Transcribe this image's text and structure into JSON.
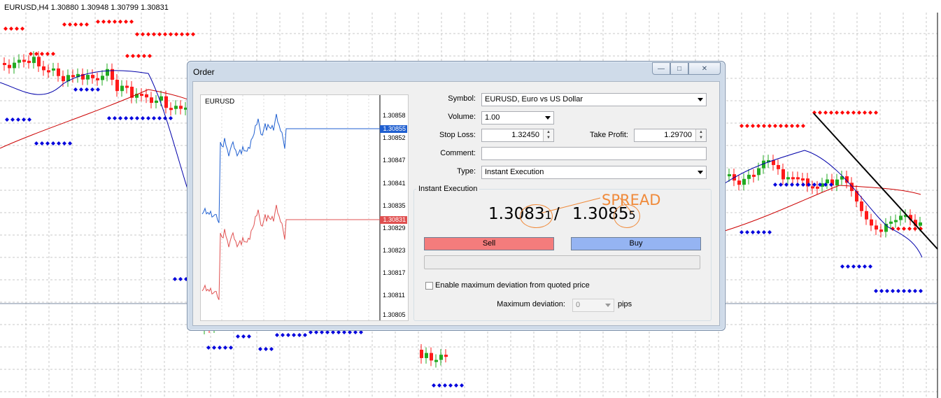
{
  "chart": {
    "title": "EURUSD,H4  1.30880 1.30948 1.30799 1.30831",
    "annotation": "SPREAD"
  },
  "window": {
    "title": "Order",
    "buttons": [
      "minimize",
      "maximize",
      "close"
    ]
  },
  "mini_chart": {
    "symbol": "EURUSD",
    "price_labels": [
      "1.30858",
      "1.30855",
      "1.30852",
      "1.30847",
      "1.30841",
      "1.30835",
      "1.30831",
      "1.30829",
      "1.30823",
      "1.30817",
      "1.30811",
      "1.30805"
    ],
    "ask_tag": "1.30855",
    "bid_tag": "1.30831",
    "ask_color": "#1f5fd0",
    "bid_color": "#e05050"
  },
  "form": {
    "symbol_label": "Symbol:",
    "symbol_value": "EURUSD, Euro vs US Dollar",
    "volume_label": "Volume:",
    "volume_value": "1.00",
    "stop_loss_label": "Stop Loss:",
    "stop_loss_value": "1.32450",
    "take_profit_label": "Take Profit:",
    "take_profit_value": "1.29700",
    "comment_label": "Comment:",
    "comment_value": "",
    "type_label": "Type:",
    "type_value": "Instant Execution"
  },
  "execution": {
    "group_title": "Instant Execution",
    "bid_main": "1.3083",
    "bid_small": "1",
    "separator": " / ",
    "ask_main": "1.3085",
    "ask_small": "5",
    "sell_label": "Sell",
    "buy_label": "Buy",
    "deviation_checkbox_label": "Enable maximum deviation from quoted price",
    "deviation_checked": false,
    "max_deviation_label": "Maximum deviation:",
    "max_deviation_value": "0",
    "pips_label": "pips"
  },
  "colors": {
    "sell": "#f47c7c",
    "buy": "#95b4f2",
    "spread_annotation": "#f08a3a"
  }
}
